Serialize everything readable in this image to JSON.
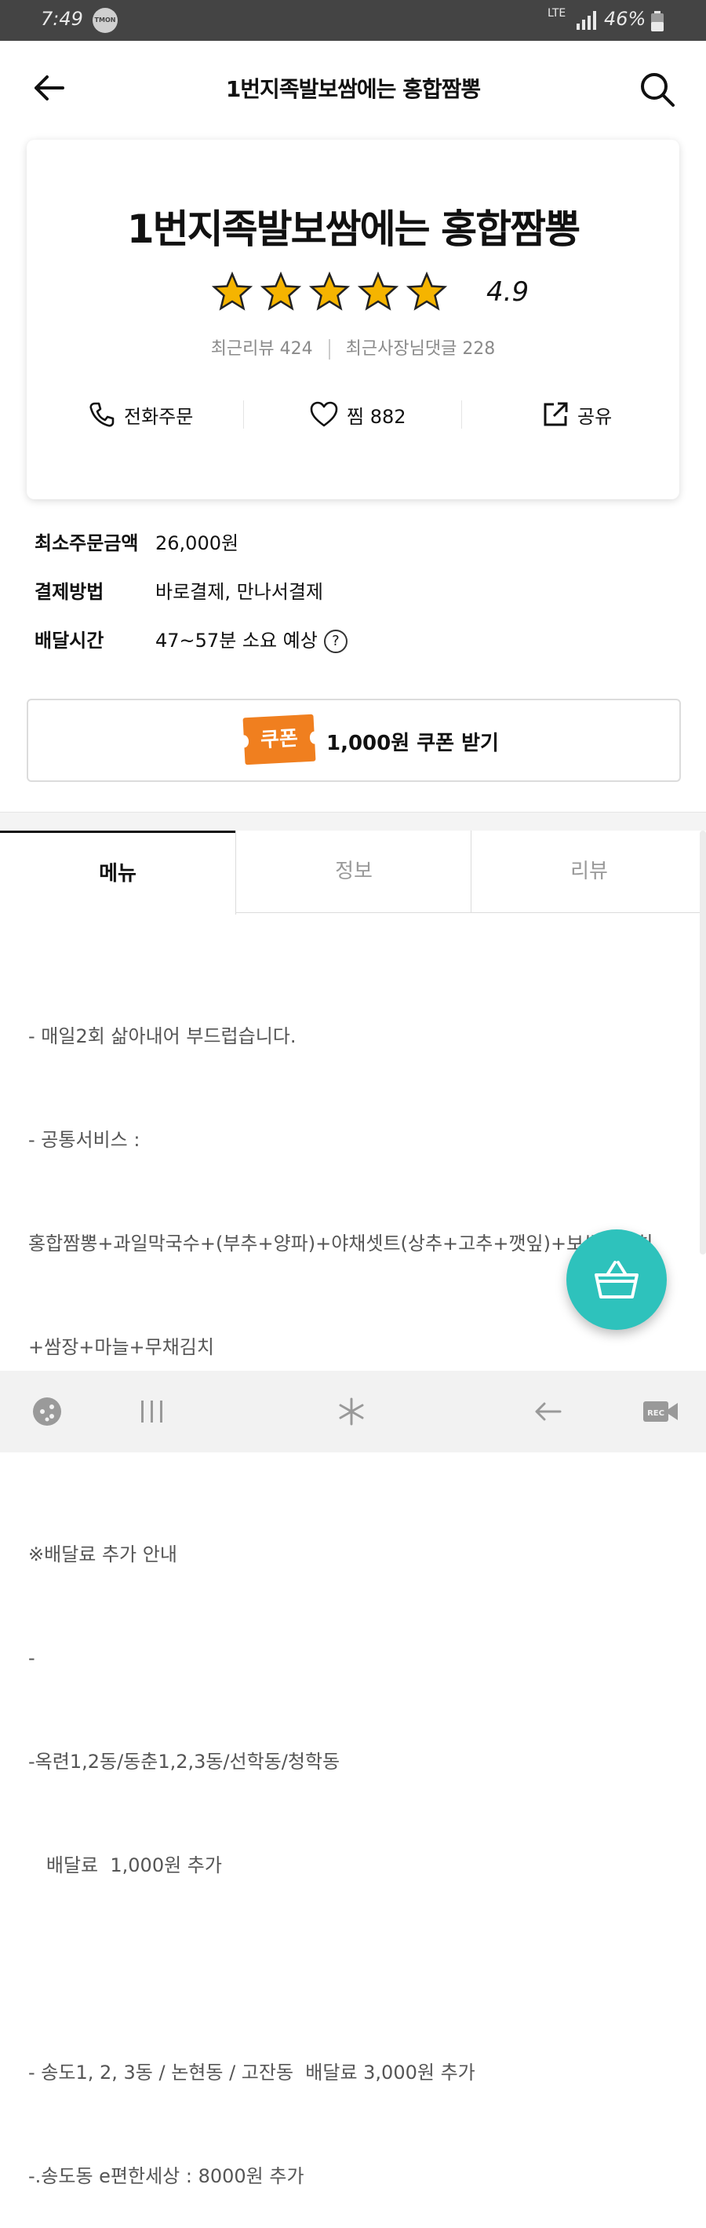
{
  "status_bar": {
    "time": "7:49",
    "app_badge": "TMON",
    "network": "LTE",
    "battery": "46%"
  },
  "header": {
    "title": "1번지족발보쌈에는 홍합짬뽕"
  },
  "store": {
    "name": "1번지족발보쌈에는 홍합짬뽕",
    "rating": 4.9,
    "rating_text": "4.9",
    "stars": 5,
    "recent_reviews": "최근리뷰 424",
    "recent_owner_replies": "최근사장님댓글 228",
    "actions": {
      "call": "전화주문",
      "like": "찜 882",
      "share": "공유"
    }
  },
  "info": {
    "min_order_label": "최소주문금액",
    "min_order_value": "26,000원",
    "payment_label": "결제방법",
    "payment_value": "바로결제, 만나서결제",
    "delivery_label": "배달시간",
    "delivery_value": "47~57분 소요 예상"
  },
  "coupon": {
    "badge": "쿠폰",
    "text": "1,000원 쿠폰 받기"
  },
  "tabs": [
    {
      "label": "메뉴",
      "active": true
    },
    {
      "label": "정보",
      "active": false
    },
    {
      "label": "리뷰",
      "active": false
    }
  ],
  "description": {
    "lines": [
      "- 매일2회 삶아내어 부드럽습니다.",
      "- 공통서비스 :",
      "홍합짬뽕+과일막국수+(부추+양파)+야채셋트(상추+고추+깻잎)+보쌈백김치",
      "+쌈장+마늘+무채김치",
      "",
      "※배달료 추가 안내",
      "-",
      "-옥련1,2동/동춘1,2,3동/선학동/청학동",
      "   배달료  1,000원 추가",
      "",
      "- 송도1, 2, 3동 / 논현동 / 고잔동  배달료 3,000원 추가",
      "-.송도동 e편한세상 : 8000원 추가"
    ]
  },
  "colors": {
    "accent": "#2ec2bc",
    "coupon": "#f07f1f",
    "star": "#f5b400",
    "status_bar": "#444444"
  },
  "icons": {
    "back": "arrow-left-icon",
    "search": "search-icon",
    "call": "phone-icon",
    "like": "heart-icon",
    "share": "share-icon",
    "help": "question-circle-icon",
    "cart": "basket-icon"
  }
}
